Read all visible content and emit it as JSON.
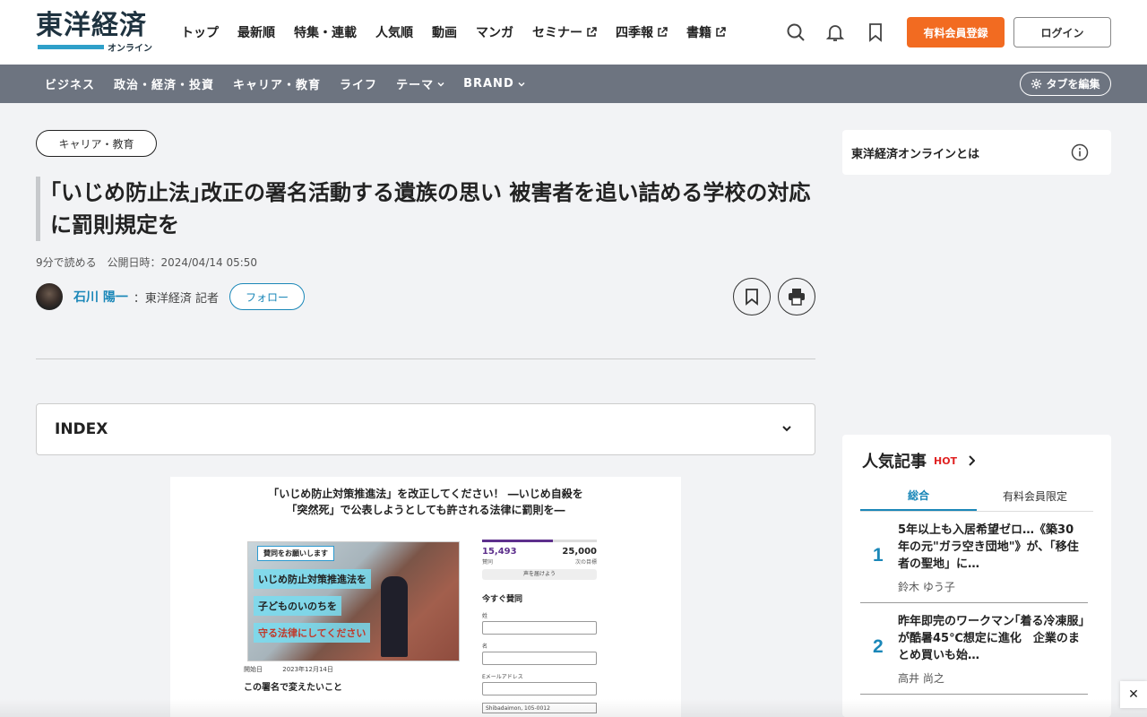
{
  "header": {
    "logo_main": "東洋経済",
    "logo_sub": "オンライン",
    "nav": [
      {
        "label": "トップ",
        "external": false
      },
      {
        "label": "最新順",
        "external": false
      },
      {
        "label": "特集・連載",
        "external": false
      },
      {
        "label": "人気順",
        "external": false
      },
      {
        "label": "動画",
        "external": false
      },
      {
        "label": "マンガ",
        "external": false
      },
      {
        "label": "セミナー",
        "external": true
      },
      {
        "label": "四季報",
        "external": true
      },
      {
        "label": "書籍",
        "external": true
      }
    ],
    "register_label": "有料会員登録",
    "login_label": "ログイン",
    "accent_color": "#f26b21"
  },
  "subnav": {
    "items": [
      {
        "label": "ビジネス"
      },
      {
        "label": "政治・経済・投資"
      },
      {
        "label": "キャリア・教育"
      },
      {
        "label": "ライフ"
      },
      {
        "label": "テーマ"
      },
      {
        "label": "BRAND"
      }
    ],
    "edit_tabs_label": "タブを編集"
  },
  "article": {
    "category": "キャリア・教育",
    "title": "｢いじめ防止法｣改正の署名活動する遺族の思い 被害者を追い詰める学校の対応に罰則規定を",
    "read_time": "9分で読める",
    "published": "公開日時：2024/04/14 05:50",
    "author_name": "石川 陽一",
    "author_affiliation": "：東洋経済 記者",
    "follow_label": "フォロー",
    "index_label": "INDEX"
  },
  "article_image": {
    "headline_1": "「いじめ防止対策推進法」を改正してください！ ―いじめ自殺を",
    "headline_2": "「突然死」で公表しようとしても許される法律に罰則を―",
    "tag": "賛同をお願いします",
    "line_1": "いじめ防止対策推進法を",
    "line_2": "子どものいのちを",
    "line_3": "守る法律にしてください",
    "start_label": "開始日",
    "start_date": "2023年12月14日",
    "subheading": "この署名で変えたいこと",
    "signatures": "15,493",
    "goal": "25,000",
    "signatures_label": "賛同",
    "goal_label": "次の目標",
    "progress": 0.62,
    "share_label": "声を届けよう",
    "sign_now": "今すぐ賛同",
    "field_1": "姓",
    "field_2": "名",
    "field_3": "Eメールアドレス",
    "address": "Shibadaimon, 105-0012"
  },
  "sidebar": {
    "about_label": "東洋経済オンラインとは",
    "popular_title": "人気記事",
    "popular_hot": "HOT",
    "tabs": [
      "総合",
      "有料会員限定"
    ],
    "items": [
      {
        "rank": "1",
        "text": "5年以上も入居希望ゼロ…《築30年の元\"ガラ空き団地\"》が、「移住者の聖地」に…",
        "author": "鈴木 ゆう子"
      },
      {
        "rank": "2",
        "text": "昨年即完のワークマン｢着る冷凍服｣が酷暑45℃想定に進化　企業のまとめ買いも始…",
        "author": "高井 尚之"
      }
    ]
  },
  "close_label": "✕"
}
